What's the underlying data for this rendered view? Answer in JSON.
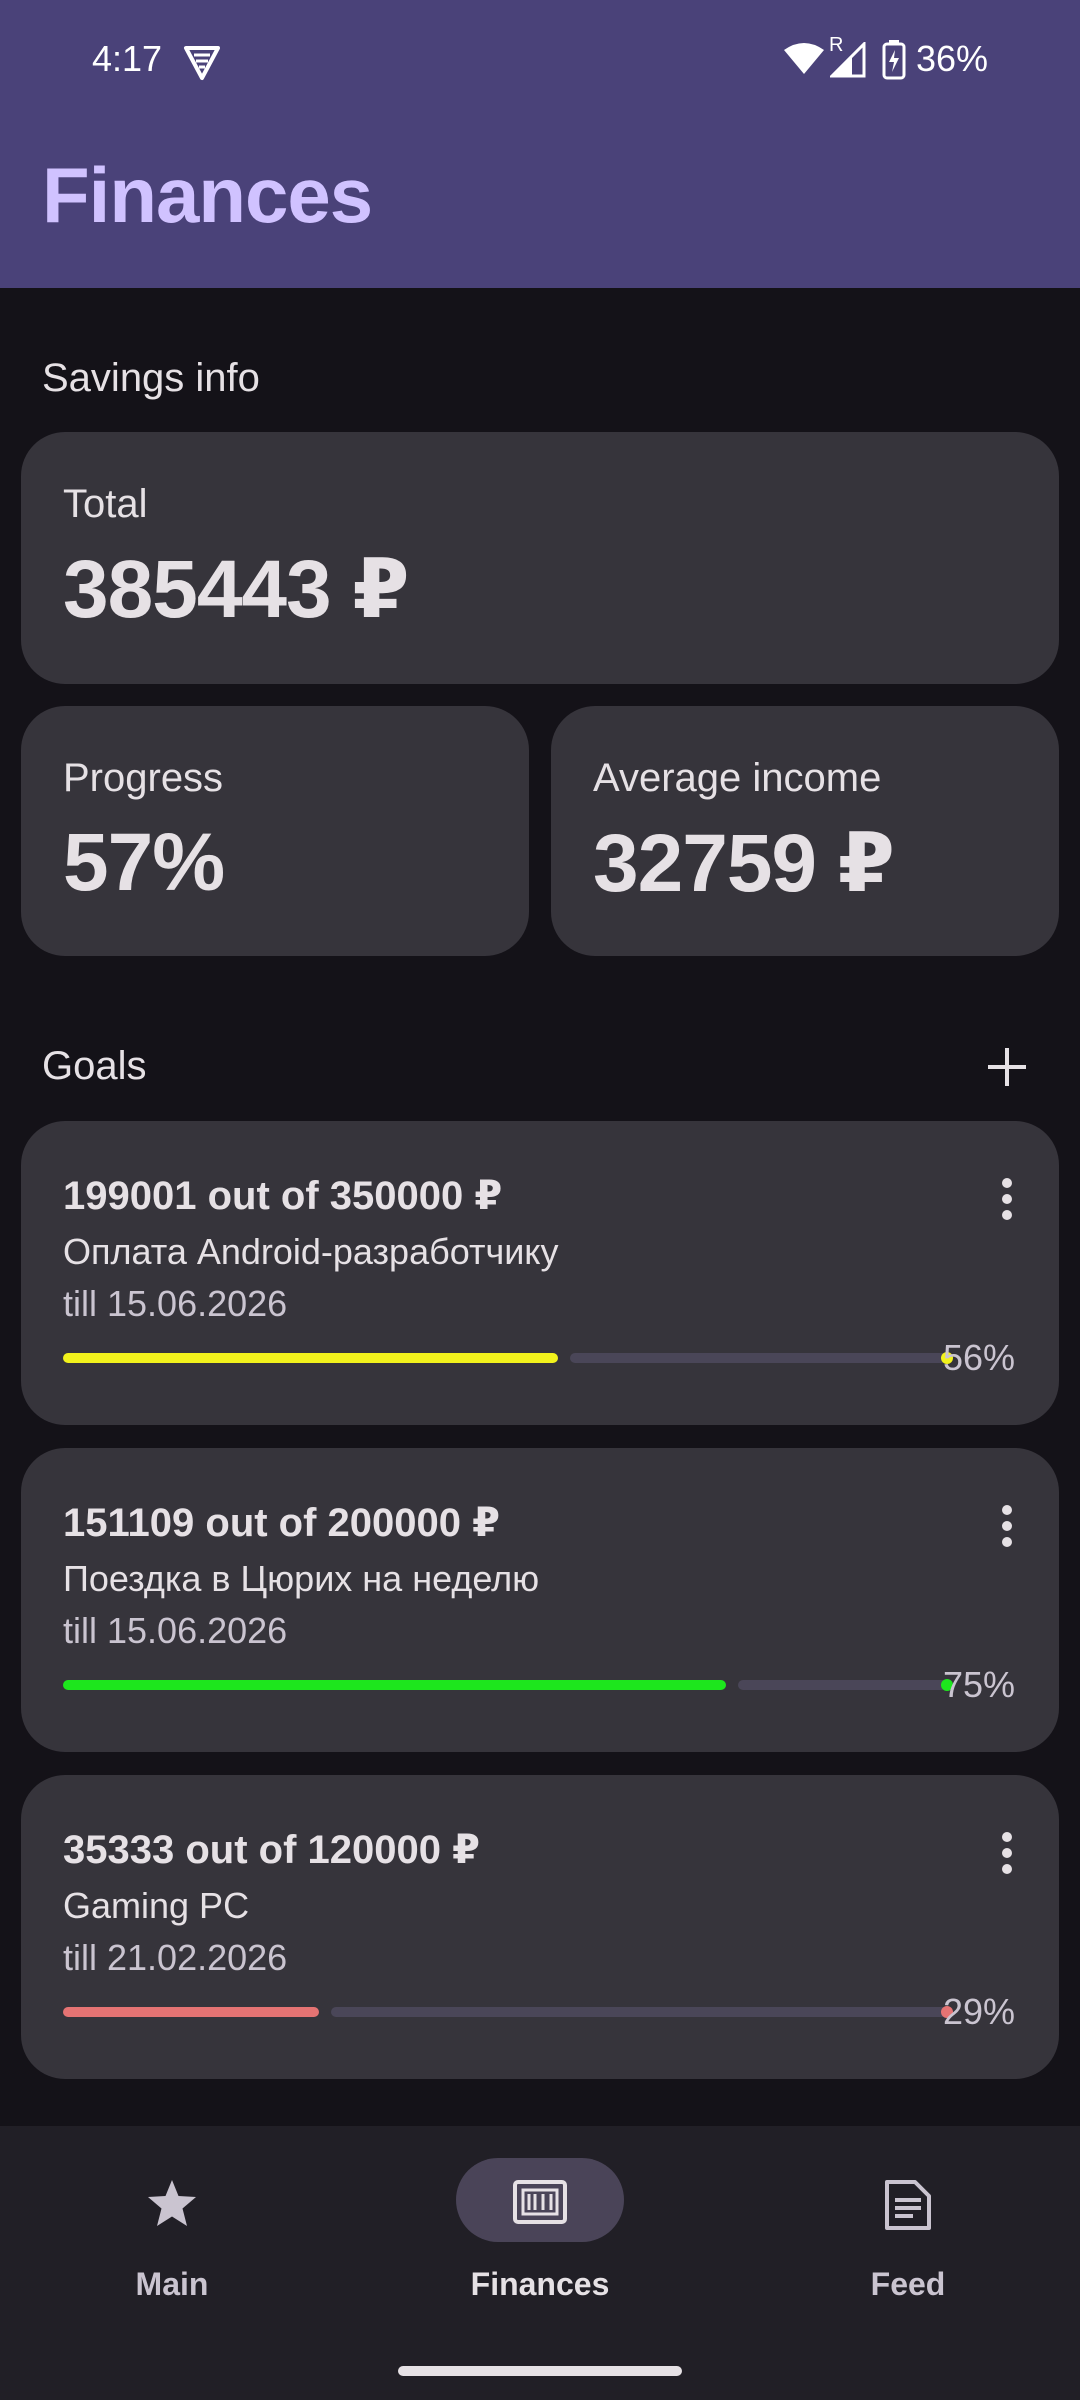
{
  "status_bar": {
    "time": "4:17",
    "battery": "36%",
    "roaming": "R"
  },
  "app": {
    "title": "Finances"
  },
  "savings": {
    "section_label": "Savings info",
    "total": {
      "label": "Total",
      "value": "385443 ₽"
    },
    "progress": {
      "label": "Progress",
      "value": "57%"
    },
    "average_income": {
      "label": "Average income",
      "value": "32759 ₽"
    }
  },
  "goals": {
    "section_label": "Goals",
    "items": [
      {
        "amount": "199001 out of 350000 ₽",
        "name": "Оплата Android-разработчику",
        "date": "till 15.06.2026",
        "percent": "56%",
        "progress": 0.56,
        "color": "#f2f21c"
      },
      {
        "amount": "151109 out of 200000 ₽",
        "name": "Поездка в Цюрих на неделю",
        "date": "till 15.06.2026",
        "percent": "75%",
        "progress": 0.75,
        "color": "#1de61d"
      },
      {
        "amount": "35333 out of 120000 ₽",
        "name": "Gaming PC",
        "date": "till 21.02.2026",
        "percent": "29%",
        "progress": 0.29,
        "color": "#e57373"
      }
    ]
  },
  "nav": {
    "main": "Main",
    "finances": "Finances",
    "feed": "Feed"
  },
  "colors": {
    "accent": "#d0c2ff",
    "app_bar": "#4a4279",
    "background": "#141218",
    "card": "#36343b"
  }
}
